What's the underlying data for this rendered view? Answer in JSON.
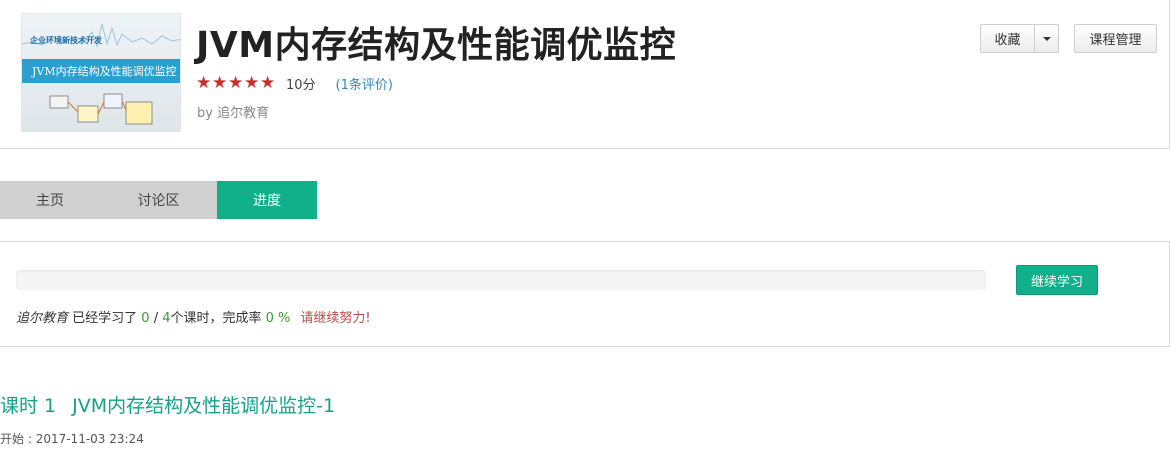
{
  "course": {
    "cover": {
      "subtitle": "企业环境新技术开发",
      "band_title": "JVM内存结构及性能调优监控"
    },
    "title": "JVM内存结构及性能调优监控",
    "rating": {
      "stars": 5,
      "max": 5,
      "score": "10分",
      "reviews": "(1条评价)"
    },
    "byline": "by 追尔教育"
  },
  "actions": {
    "favorite_label": "收藏",
    "manage_label": "课程管理"
  },
  "tabs": [
    {
      "label": "主页",
      "active": false
    },
    {
      "label": "讨论区",
      "active": false
    },
    {
      "label": "进度",
      "active": true
    }
  ],
  "progress": {
    "percent": 0,
    "continue_label": "继续学习",
    "user": "追尔教育",
    "text_learned": " 已经学习了 ",
    "learned": "0",
    "separator": " / ",
    "total": "4",
    "text_lessons": "个课时，完成率 ",
    "rate": "0 %",
    "encourage": "请继续努力!"
  },
  "lesson": {
    "number": "课时 1",
    "title": "JVM内存结构及性能调优监控-1",
    "start_label": "开始 : ",
    "start_time": "2017-11-03 23:24"
  },
  "colors": {
    "accent": "#12b08a",
    "star": "#c9302c",
    "link": "#2f87c6",
    "encourage": "#b94a48"
  }
}
